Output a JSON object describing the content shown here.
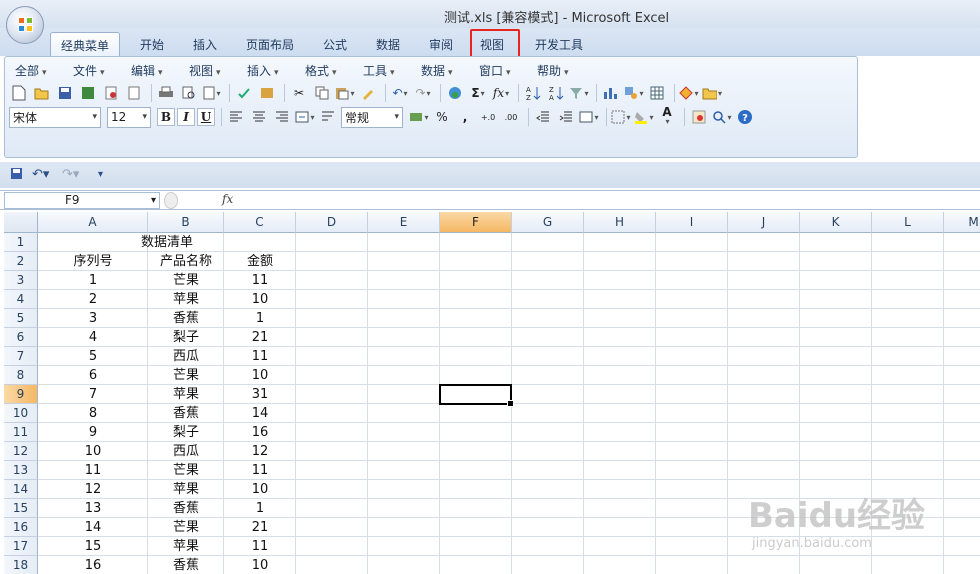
{
  "window": {
    "title": "测试.xls  [兼容模式] - Microsoft Excel"
  },
  "tabs": [
    {
      "label": "经典菜单"
    },
    {
      "label": "开始"
    },
    {
      "label": "插入"
    },
    {
      "label": "页面布局"
    },
    {
      "label": "公式"
    },
    {
      "label": "数据"
    },
    {
      "label": "审阅"
    },
    {
      "label": "视图"
    },
    {
      "label": "开发工具"
    }
  ],
  "menus": [
    "全部",
    "文件",
    "编辑",
    "视图",
    "插入",
    "格式",
    "工具",
    "数据",
    "窗口",
    "帮助"
  ],
  "font": {
    "name": "宋体",
    "size": "12",
    "bold": "B",
    "italic": "I",
    "underline": "U",
    "number_format": "常规"
  },
  "toolbar_glyphs": {
    "autosum": "Σ",
    "fx": "fx",
    "percent": "%",
    "comma": ",",
    "inc_decimal": "+.0",
    "dec_decimal": ".00",
    "font_color": "A",
    "help": "?"
  },
  "namebox": {
    "value": "F9"
  },
  "formula": {
    "fx_label": "fx",
    "value": ""
  },
  "columns": [
    "A",
    "B",
    "C",
    "D",
    "E",
    "F",
    "G",
    "H",
    "I",
    "J",
    "K",
    "L",
    "M"
  ],
  "selected_column": "F",
  "selected_row": 9,
  "rows": [
    {
      "n": "1",
      "a": "",
      "b": "数据清单",
      "c": ""
    },
    {
      "n": "2",
      "a": "序列号",
      "b": "产品名称",
      "c": "金额"
    },
    {
      "n": "3",
      "a": "1",
      "b": "芒果",
      "c": "11"
    },
    {
      "n": "4",
      "a": "2",
      "b": "苹果",
      "c": "10"
    },
    {
      "n": "5",
      "a": "3",
      "b": "香蕉",
      "c": "1"
    },
    {
      "n": "6",
      "a": "4",
      "b": "梨子",
      "c": "21"
    },
    {
      "n": "7",
      "a": "5",
      "b": "西瓜",
      "c": "11"
    },
    {
      "n": "8",
      "a": "6",
      "b": "芒果",
      "c": "10"
    },
    {
      "n": "9",
      "a": "7",
      "b": "苹果",
      "c": "31"
    },
    {
      "n": "10",
      "a": "8",
      "b": "香蕉",
      "c": "14"
    },
    {
      "n": "11",
      "a": "9",
      "b": "梨子",
      "c": "16"
    },
    {
      "n": "12",
      "a": "10",
      "b": "西瓜",
      "c": "12"
    },
    {
      "n": "13",
      "a": "11",
      "b": "芒果",
      "c": "11"
    },
    {
      "n": "14",
      "a": "12",
      "b": "苹果",
      "c": "10"
    },
    {
      "n": "15",
      "a": "13",
      "b": "香蕉",
      "c": "1"
    },
    {
      "n": "16",
      "a": "14",
      "b": "芒果",
      "c": "21"
    },
    {
      "n": "17",
      "a": "15",
      "b": "苹果",
      "c": "11"
    },
    {
      "n": "18",
      "a": "16",
      "b": "香蕉",
      "c": "10"
    }
  ],
  "watermark": {
    "main": "Baidu经验",
    "sub": "jingyan.baidu.com"
  },
  "colors": {
    "highlight_box": "#e62720",
    "selected_header": "#f5b763"
  }
}
